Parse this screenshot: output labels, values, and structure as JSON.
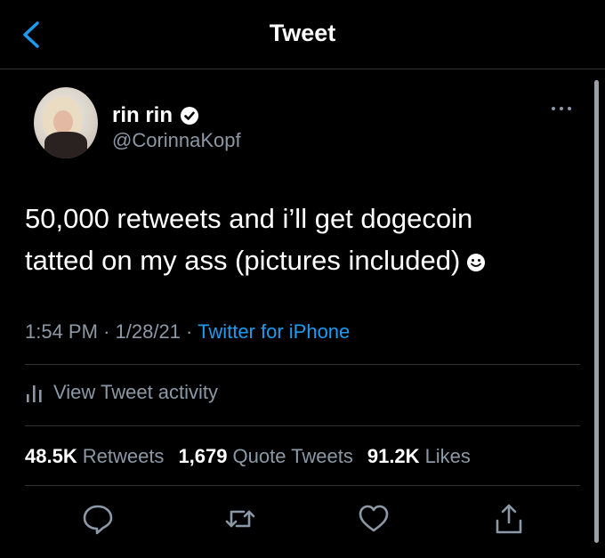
{
  "header": {
    "title": "Tweet"
  },
  "tweet": {
    "name": "rin rin",
    "handle": "@CorinnaKopf",
    "text_line1": "50,000 retweets and i’ll get dogecoin",
    "text_line2": "tatted on my ass (pictures included)",
    "time": "1:54 PM",
    "date": "1/28/21",
    "source": "Twitter for iPhone",
    "activity_label": "View Tweet activity",
    "retweets_count": "48.5K",
    "retweets_label": "Retweets",
    "quotes_count": "1,679",
    "quotes_label": "Quote Tweets",
    "likes_count": "91.2K",
    "likes_label": "Likes"
  },
  "colors": {
    "background": "#000000",
    "muted": "#8b98a5",
    "accent": "#1d9bf0",
    "divider": "#2f3336"
  },
  "icons": [
    "back-icon",
    "verified-icon",
    "more-icon",
    "smiley-icon",
    "activity-icon",
    "reply-icon",
    "retweet-icon",
    "like-icon",
    "share-icon"
  ]
}
